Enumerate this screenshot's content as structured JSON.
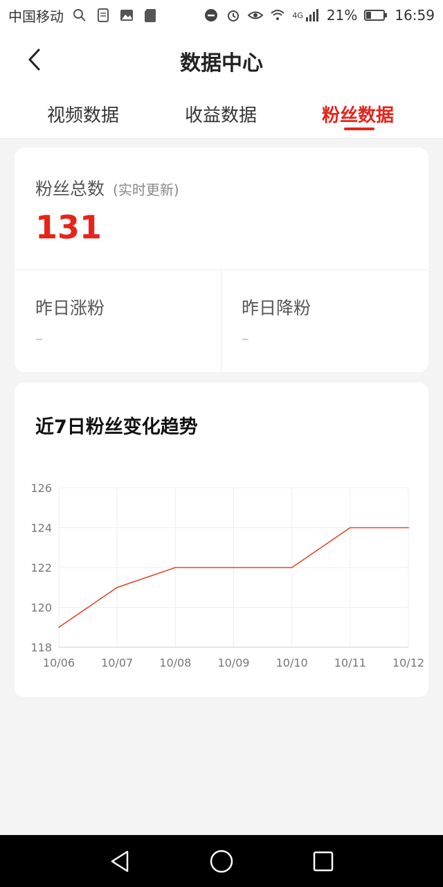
{
  "status_bar": {
    "carrier": "中国移动",
    "network": "4G",
    "battery": "21%",
    "time": "16:59",
    "icons": [
      "search-icon",
      "file-icon",
      "image-icon",
      "sd-card-icon",
      "dnd-icon",
      "alarm-icon",
      "eye-icon",
      "wifi-icon",
      "signal-icon",
      "battery-icon"
    ]
  },
  "header": {
    "title": "数据中心"
  },
  "tabs": [
    {
      "label": "视频数据"
    },
    {
      "label": "收益数据"
    },
    {
      "label": "粉丝数据",
      "active": true
    }
  ],
  "fans": {
    "total_label": "粉丝总数",
    "total_note": "(实时更新)",
    "total_value": "131",
    "gain_label": "昨日涨粉",
    "gain_value": "–",
    "loss_label": "昨日降粉",
    "loss_value": "–"
  },
  "chart": {
    "title": "近7日粉丝变化趋势"
  },
  "chart_data": {
    "type": "line",
    "x": [
      "10/06",
      "10/07",
      "10/08",
      "10/09",
      "10/10",
      "10/11",
      "10/12"
    ],
    "series": [
      {
        "values": [
          119,
          121,
          122,
          122,
          122,
          124,
          124
        ]
      }
    ],
    "yticks": [
      118,
      120,
      122,
      124,
      126
    ],
    "ylim": [
      118,
      126
    ],
    "grid": true,
    "line_color": "#e8432a"
  },
  "colors": {
    "accent": "#e8231a",
    "background": "#f4f4f4"
  }
}
